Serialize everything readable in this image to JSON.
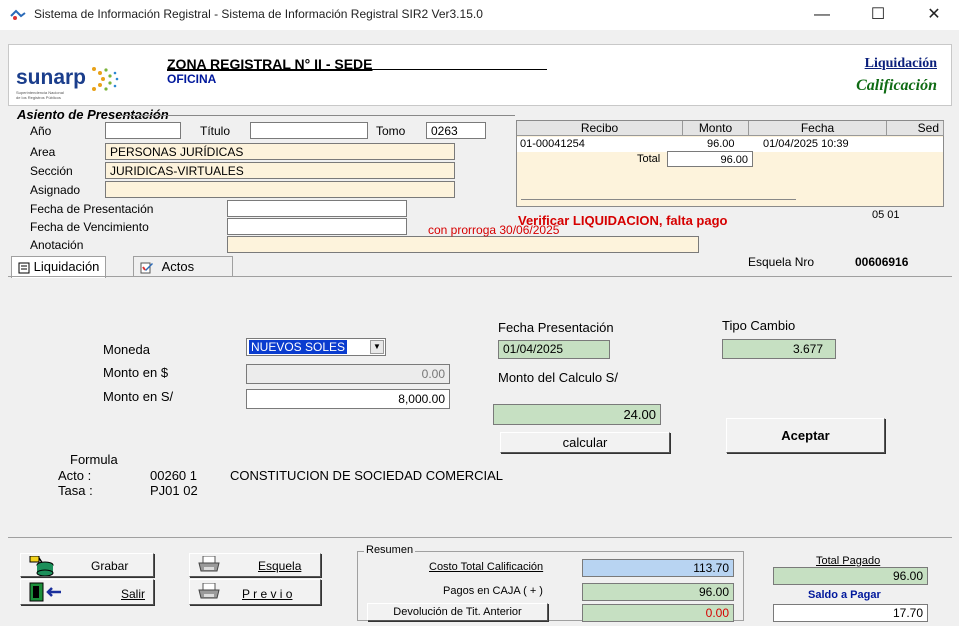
{
  "window": {
    "title": "Sistema de Información Registral - Sistema de Información Registral SIR2   Ver3.15.0",
    "minimize": "—",
    "maximize": "☐",
    "close": "✕"
  },
  "header": {
    "logo_text": "sunarp",
    "logo_tagline": "Superintendencia Nacional de los Registros Públicos",
    "zone_title": "ZONA REGISTRAL N° II - SEDE",
    "oficina": "OFICINA",
    "liquidacion_link": "Liquidación",
    "calificacion": "Calificación"
  },
  "asiento": {
    "section_title": "Asiento de Presentación",
    "labels": {
      "anio": "Año",
      "titulo": "Título",
      "tomo": "Tomo",
      "area": "Area",
      "seccion": "Sección",
      "asignado": "Asignado",
      "fecha_presentacion": "Fecha de Presentación",
      "fecha_vencimiento": "Fecha de Vencimiento",
      "anotacion": "Anotación"
    },
    "values": {
      "anio": "",
      "titulo": "",
      "tomo": "0263",
      "area": "PERSONAS JURÍDICAS",
      "seccion": "JURIDICAS-VIRTUALES",
      "asignado": "",
      "fecha_presentacion": "",
      "fecha_vencimiento": "",
      "anotacion": ""
    }
  },
  "receipts": {
    "columns": [
      "Recibo",
      "Monto",
      "Fecha",
      "Sed"
    ],
    "rows": [
      {
        "recibo": "01-00041254",
        "monto": "96.00",
        "fecha": "01/04/2025 10:39"
      }
    ],
    "total_label": "Total",
    "total_value": "96.00",
    "side_code": "05  01"
  },
  "alerts": {
    "warning": "Verificar LIQUIDACION,  falta pago",
    "prorroga": "con prorroga 30/06/2025"
  },
  "tabs": [
    {
      "label": "Liquidación",
      "icon": "document-icon",
      "active": true
    },
    {
      "label": "Actos",
      "icon": "edit-icon",
      "active": false
    }
  ],
  "esquela": {
    "label": "Esquela Nro",
    "number": "00606916"
  },
  "liquidacion": {
    "moneda_label": "Moneda",
    "moneda_value": "NUEVOS SOLES",
    "monto_dolares_label": "Monto en $",
    "monto_dolares_value": "0.00",
    "monto_soles_label": "Monto en S/",
    "monto_soles_value": "8,000.00",
    "fecha_presentacion_label": "Fecha Presentación",
    "fecha_presentacion_value": "01/04/2025",
    "tipo_cambio_label": "Tipo Cambio",
    "tipo_cambio_value": "3.677",
    "monto_calculo_label": "Monto del Calculo S/",
    "monto_calculo_value": "24.00",
    "calcular_button": "calcular",
    "aceptar_button": "Aceptar"
  },
  "formula": {
    "title": "Formula",
    "acto_label": "Acto :",
    "acto_code": "00260 1",
    "acto_desc": "CONSTITUCION DE SOCIEDAD COMERCIAL",
    "tasa_label": "Tasa :",
    "tasa_code": "PJ01  02"
  },
  "actions": {
    "grabar": "Grabar",
    "salir": "Salir",
    "esquela": "Esquela",
    "previo": "P r e v i o"
  },
  "resumen": {
    "title": "Resumen",
    "costo_total_label": "Costo Total Calificación",
    "costo_total_value": "113.70",
    "pagos_caja_label": "Pagos en CAJA  ( + )",
    "pagos_caja_value": "96.00",
    "devolucion_label": "Devolución de Tit. Anterior",
    "devolucion_value": "0.00",
    "total_pagado_label": "Total Pagado",
    "total_pagado_value": "96.00",
    "saldo_label": "Saldo a Pagar",
    "saldo_value": "17.70"
  },
  "colors": {
    "field_cream": "#fdf3dc",
    "field_green": "#c6e0c2",
    "field_blue": "#b8d4f2",
    "alert_red": "#d60000",
    "link_blue": "#0a1f7c",
    "calif_green": "#0f6b14"
  }
}
